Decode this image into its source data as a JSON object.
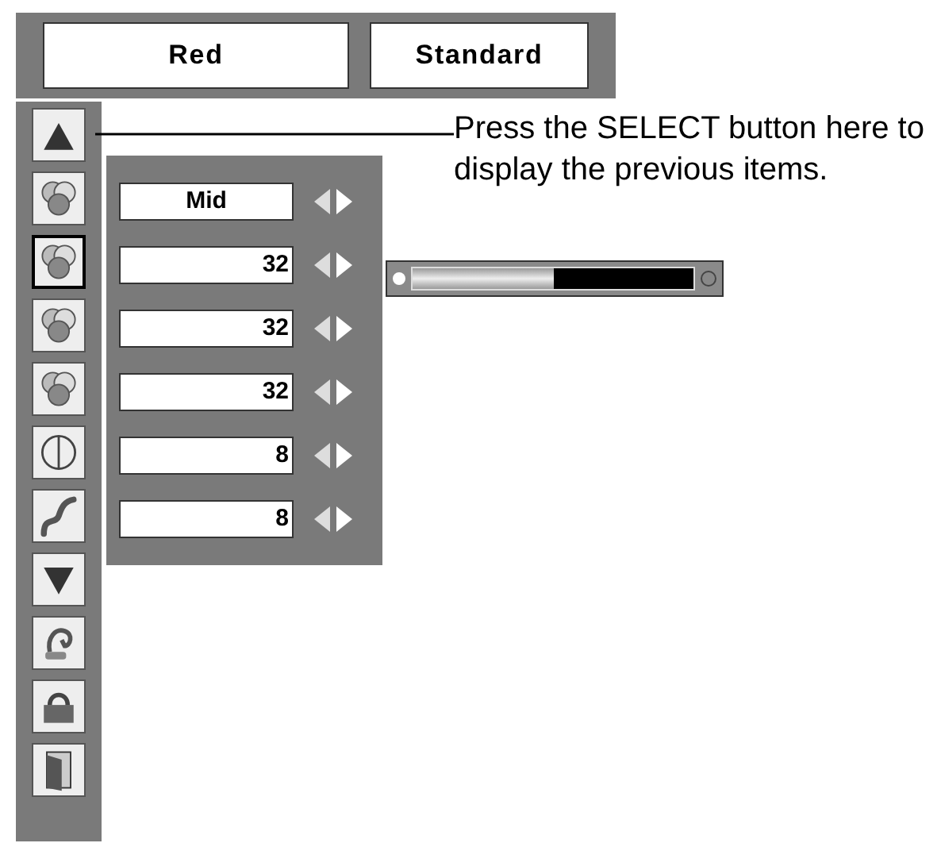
{
  "header": {
    "color_box": "Red",
    "mode_box": "Standard"
  },
  "sidebar": {
    "items": [
      {
        "kind": "up",
        "selected": false
      },
      {
        "kind": "color",
        "selected": false
      },
      {
        "kind": "color",
        "selected": true
      },
      {
        "kind": "color",
        "selected": false
      },
      {
        "kind": "color",
        "selected": false
      },
      {
        "kind": "split-circle",
        "selected": false
      },
      {
        "kind": "curve",
        "selected": false
      },
      {
        "kind": "down",
        "selected": false
      },
      {
        "kind": "reset",
        "selected": false
      },
      {
        "kind": "store",
        "selected": false
      },
      {
        "kind": "exit",
        "selected": false
      }
    ]
  },
  "settings": [
    {
      "kind": "mode",
      "value": "Mid"
    },
    {
      "kind": "number",
      "value": "32"
    },
    {
      "kind": "number",
      "value": "32"
    },
    {
      "kind": "number",
      "value": "32"
    },
    {
      "kind": "number",
      "value": "8"
    },
    {
      "kind": "number",
      "value": "8"
    }
  ],
  "slider": {
    "level": 0.5
  },
  "callout": "Press the SELECT button here to display the previous items."
}
